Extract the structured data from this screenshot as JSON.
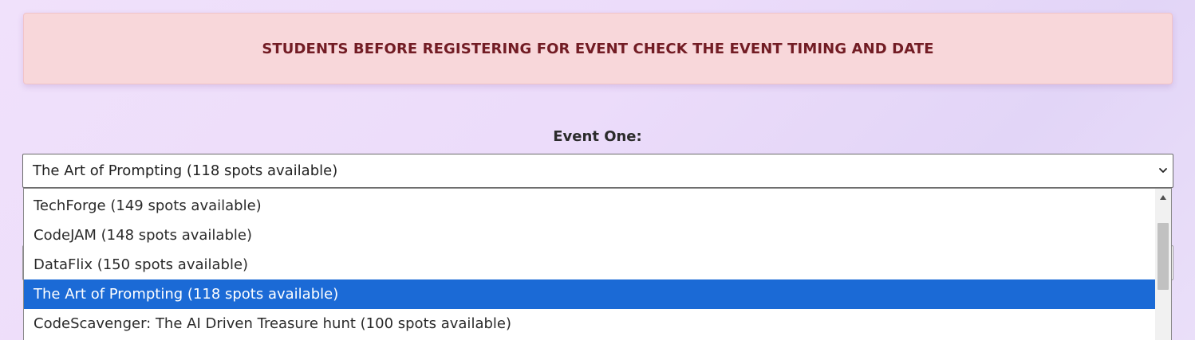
{
  "notice": {
    "text": "STUDENTS BEFORE REGISTERING FOR EVENT CHECK THE EVENT TIMING AND DATE"
  },
  "event_one": {
    "label": "Event One:",
    "selected_value": "The Art of Prompting (118 spots available)",
    "options": [
      "TechForge (149 spots available)",
      "CodeJAM (148 spots available)",
      "DataFlix (150 spots available)",
      "The Art of Prompting (118 spots available)",
      "CodeScavenger: The AI Driven Treasure hunt (100 spots available)"
    ],
    "highlighted_option": "The Art of Prompting (118 spots available)"
  },
  "icons": {
    "select_toggle": "chevron-down-icon",
    "scroll_up": "scroll-up-arrow-icon"
  },
  "colors": {
    "notice_background": "#f8d7da",
    "notice_text": "#721c24",
    "option_highlight": "#1b6ad6"
  }
}
